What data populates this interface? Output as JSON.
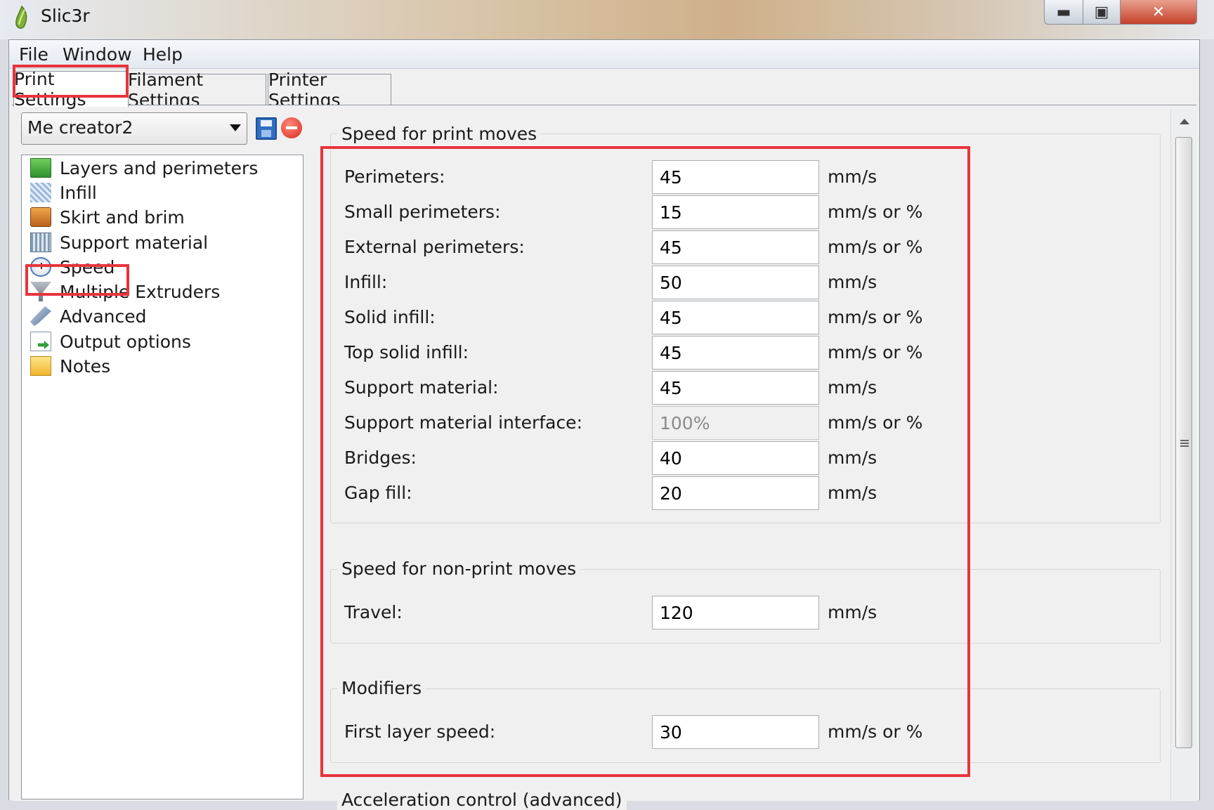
{
  "window": {
    "title": "Slic3r",
    "minimize_icon": "minimize-icon",
    "maximize_icon": "maximize-icon",
    "close_icon": "close-icon"
  },
  "menu": {
    "file": "File",
    "window": "Window",
    "help": "Help"
  },
  "tabs": [
    {
      "label": "Print Settings",
      "active": true
    },
    {
      "label": "Filament Settings",
      "active": false
    },
    {
      "label": "Printer Settings",
      "active": false
    }
  ],
  "preset": {
    "selected": "Me creator2"
  },
  "sidebar": {
    "items": [
      {
        "label": "Layers and perimeters",
        "icon": "layers-icon"
      },
      {
        "label": "Infill",
        "icon": "infill-icon"
      },
      {
        "label": "Skirt and brim",
        "icon": "skirt-icon"
      },
      {
        "label": "Support material",
        "icon": "support-icon"
      },
      {
        "label": "Speed",
        "icon": "speed-icon",
        "selected": true
      },
      {
        "label": "Multiple Extruders",
        "icon": "extruder-icon"
      },
      {
        "label": "Advanced",
        "icon": "wrench-icon"
      },
      {
        "label": "Output options",
        "icon": "output-icon"
      },
      {
        "label": "Notes",
        "icon": "notes-icon"
      }
    ]
  },
  "groups": {
    "print_moves": {
      "title": "Speed for print moves",
      "rows": [
        {
          "label": "Perimeters:",
          "value": "45",
          "unit": "mm/s"
        },
        {
          "label": "Small perimeters:",
          "value": "15",
          "unit": "mm/s or %"
        },
        {
          "label": "External perimeters:",
          "value": "45",
          "unit": "mm/s or %"
        },
        {
          "label": "Infill:",
          "value": "50",
          "unit": "mm/s"
        },
        {
          "label": "Solid infill:",
          "value": "45",
          "unit": "mm/s or %"
        },
        {
          "label": "Top solid infill:",
          "value": "45",
          "unit": "mm/s or %"
        },
        {
          "label": "Support material:",
          "value": "45",
          "unit": "mm/s"
        },
        {
          "label": "Support material interface:",
          "value": "100%",
          "unit": "mm/s or %",
          "disabled": true
        },
        {
          "label": "Bridges:",
          "value": "40",
          "unit": "mm/s"
        },
        {
          "label": "Gap fill:",
          "value": "20",
          "unit": "mm/s"
        }
      ]
    },
    "non_print_moves": {
      "title": "Speed for non-print moves",
      "rows": [
        {
          "label": "Travel:",
          "value": "120",
          "unit": "mm/s"
        }
      ]
    },
    "modifiers": {
      "title": "Modifiers",
      "rows": [
        {
          "label": "First layer speed:",
          "value": "30",
          "unit": "mm/s or %"
        }
      ]
    },
    "acceleration": {
      "title": "Acceleration control (advanced)"
    }
  },
  "colors": {
    "highlight": "#e8343c"
  }
}
